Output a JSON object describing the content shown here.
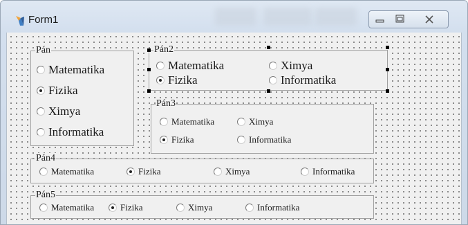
{
  "window": {
    "title": "Form1"
  },
  "titlebar": {
    "minimize_icon": "minimize-icon",
    "maximize_icon": "maximize-icon",
    "close_icon": "close-icon"
  },
  "groups": [
    {
      "label": "Pán",
      "options": [
        "Matematika",
        "Fizika",
        "Ximya",
        "Informatika"
      ],
      "selected": "Fizika"
    },
    {
      "label": "Pán2",
      "options": [
        "Matematika",
        "Ximya",
        "Fizika",
        "Informatika"
      ],
      "selected": "Fizika"
    },
    {
      "label": "Pán3",
      "options": [
        "Matematika",
        "Ximya",
        "Fizika",
        "Informatika"
      ],
      "selected": "Fizika"
    },
    {
      "label": "Pán4",
      "options": [
        "Matematika",
        "Fizika",
        "Ximya",
        "Informatika"
      ],
      "selected": "Fizika"
    },
    {
      "label": "Pán5",
      "options": [
        "Matematika",
        "Fizika",
        "Ximya",
        "Informatika"
      ],
      "selected": "Fizika"
    }
  ]
}
